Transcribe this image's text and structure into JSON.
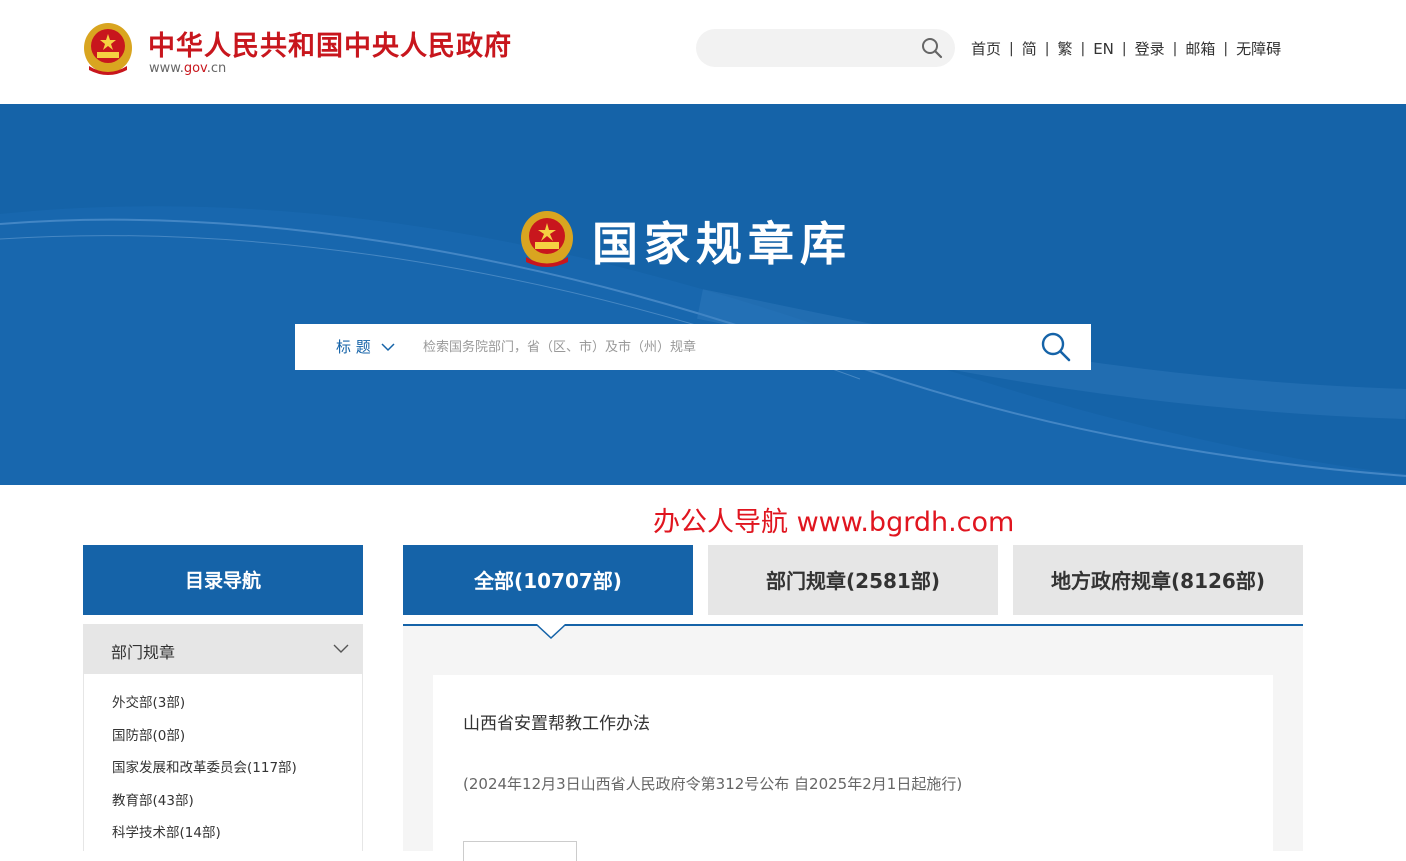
{
  "header": {
    "site_title": "中华人民共和国中央人民政府",
    "site_url_prefix": "www.",
    "site_url_domain": "gov",
    "site_url_suffix": ".cn",
    "search_placeholder": "",
    "links": [
      "首页",
      "简",
      "繁",
      "EN",
      "登录",
      "邮箱",
      "无障碍"
    ],
    "separator": "|"
  },
  "banner": {
    "title": "国家规章库",
    "search_type": "标 题",
    "search_placeholder": "检索国务院部门，省（区、市）及市（州）规章"
  },
  "watermark": "办公人导航 www.bgrdh.com",
  "sidebar": {
    "heading": "目录导航",
    "category": "部门规章",
    "items": [
      "外交部(3部)",
      "国防部(0部)",
      "国家发展和改革委员会(117部)",
      "教育部(43部)",
      "科学技术部(14部)"
    ]
  },
  "tabs": {
    "all": "全部(10707部)",
    "department": "部门规章(2581部)",
    "local": "地方政府规章(8126部)"
  },
  "results": [
    {
      "title": "山西省安置帮教工作办法",
      "meta": "(2024年12月3日山西省人民政府令第312号公布 自2025年2月1日起施行)"
    }
  ],
  "colors": {
    "brand_blue": "#1563a8",
    "brand_red": "#c8161d",
    "watermark_red": "#e0151f"
  }
}
